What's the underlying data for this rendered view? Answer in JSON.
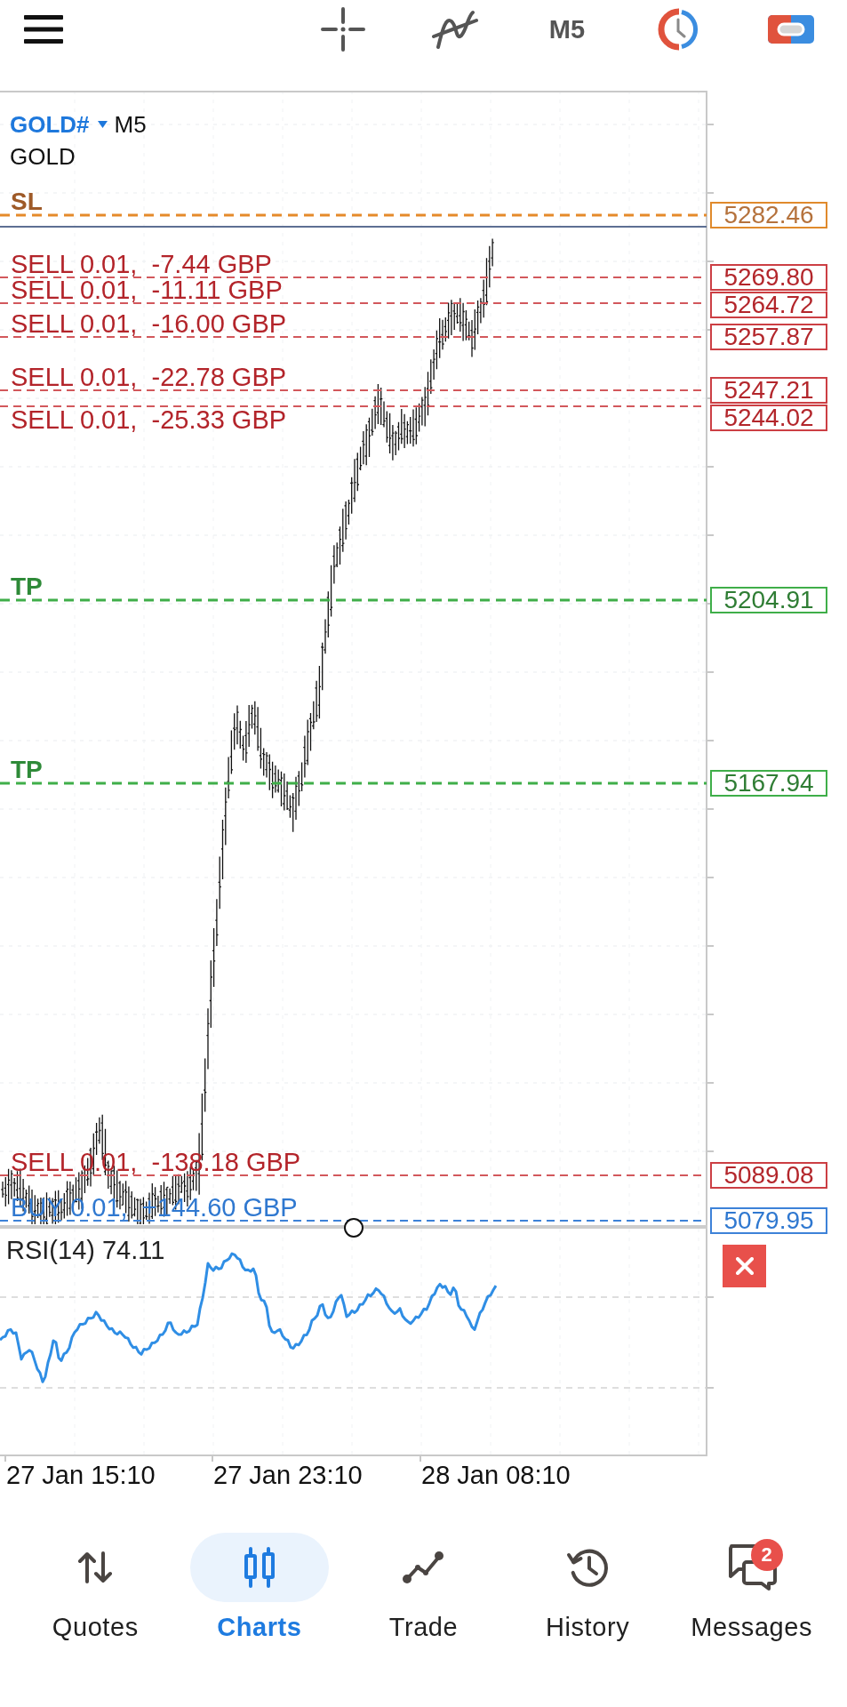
{
  "toolbar": {
    "timeframe": "M5"
  },
  "chart": {
    "symbol": "GOLD#",
    "timeframe": "M5",
    "description": "GOLD",
    "order_lines": [
      {
        "kind": "sl",
        "label": "SL",
        "price": "5282.46"
      },
      {
        "kind": "sell",
        "label": "SELL 0.01,  -7.44 GBP",
        "price": "5269.80"
      },
      {
        "kind": "sell",
        "label": "SELL 0.01,  -11.11 GBP",
        "price": "5264.72"
      },
      {
        "kind": "sell",
        "label": "SELL 0.01,  -16.00 GBP",
        "price": "5257.87"
      },
      {
        "kind": "sell",
        "label": "SELL 0.01,  -22.78 GBP",
        "price": "5247.21"
      },
      {
        "kind": "sell",
        "label": "SELL 0.01,  -25.33 GBP",
        "price": "5244.02"
      },
      {
        "kind": "tp",
        "label": "TP",
        "price": "5204.91"
      },
      {
        "kind": "tp",
        "label": "TP",
        "price": "5167.94"
      },
      {
        "kind": "sell",
        "label": "SELL 0.01,  -138.18 GBP",
        "price": "5089.08"
      },
      {
        "kind": "buy",
        "label": "BUY 0.01,  +144.60 GBP",
        "price": "5079.95"
      }
    ],
    "indicator": {
      "label": "RSI(14) 74.11"
    },
    "time_axis": [
      "27 Jan 15:10",
      "27 Jan 23:10",
      "28 Jan 08:10"
    ]
  },
  "bottom_nav": [
    {
      "label": "Quotes",
      "selected": false
    },
    {
      "label": "Charts",
      "selected": true
    },
    {
      "label": "Trade",
      "selected": false
    },
    {
      "label": "History",
      "selected": false
    },
    {
      "label": "Messages",
      "selected": false,
      "badge": "2"
    }
  ]
}
